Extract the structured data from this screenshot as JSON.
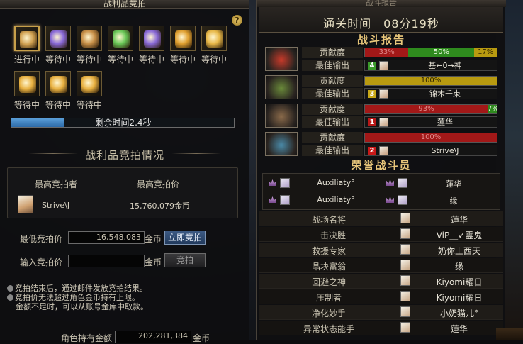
{
  "auction": {
    "title": "战利品竞拍",
    "help_icon": "?",
    "slots": [
      {
        "status": "进行中",
        "icon": "treasure-chest-icon",
        "color": "#d0a050",
        "active": true
      },
      {
        "status": "等待中",
        "icon": "purple-gem-icon",
        "color": "#8a6ad8"
      },
      {
        "status": "等待中",
        "icon": "weapon-bundle-icon",
        "color": "#c89048"
      },
      {
        "status": "等待中",
        "icon": "green-gem-icon",
        "color": "#6ac858"
      },
      {
        "status": "等待中",
        "icon": "purple-gem-icon",
        "color": "#8a6ad8"
      },
      {
        "status": "等待中",
        "icon": "gold-chest-icon",
        "color": "#e0a030"
      },
      {
        "status": "等待中",
        "icon": "gold-gear-icon",
        "color": "#e8b848"
      },
      {
        "status": "等待中",
        "icon": "gold-coin-bag-icon",
        "color": "#e8b040"
      },
      {
        "status": "等待中",
        "icon": "gold-coin-bag-icon",
        "color": "#e8b040"
      },
      {
        "status": "等待中",
        "icon": "gold-coin-bag-icon",
        "color": "#e8b040"
      }
    ],
    "timer": {
      "text": "剩余时间2.4秒",
      "progress_fraction": 0.24
    },
    "section_title": "战利品竞拍情况",
    "top_bidder_header": "最高竞拍者",
    "top_price_header": "最高竞拍价",
    "top_bidder_name": "Strive\\J",
    "top_bid_amount": "15,760,079金币",
    "min_bid_label": "最低竞拍价",
    "min_bid_value": "16,548,083",
    "unit": "金币",
    "buy_now_label": "立即竞拍",
    "input_bid_label": "输入竞拍价",
    "input_bid_value": "",
    "bid_label": "竞拍",
    "notes": [
      "竞拍结束后，通过邮件发放竞拍结果。",
      "竞拍价无法超过角色金币持有上限。",
      "金额不足时，可以从账号金库中取款。"
    ],
    "gold_label": "角色持有金额",
    "gold_value": "202,281,384",
    "gold_unit": "金币"
  },
  "report": {
    "title": "战斗报告",
    "clear_time": "通关时间　08分19秒",
    "battle_report_heading": "战斗报告",
    "contribution_label": "贡献度",
    "best_output_label": "最佳输出",
    "players": [
      {
        "portrait_color": "#c83a2a",
        "segments": [
          {
            "color": "red",
            "value": 33,
            "text": "33%"
          },
          {
            "color": "green",
            "value": 50,
            "text": "50%"
          },
          {
            "color": "gold",
            "value": 17,
            "text": "17%"
          }
        ],
        "rank": "4",
        "rank_color": "#3a9a2a",
        "best": "基←0→神"
      },
      {
        "portrait_color": "#6a8a3a",
        "segments": [
          {
            "color": "gold",
            "value": 100,
            "text": "100%"
          }
        ],
        "rank": "3",
        "rank_color": "#c8a818",
        "best": "锦木千束"
      },
      {
        "portrait_color": "#8a6a4a",
        "segments": [
          {
            "color": "red",
            "value": 93,
            "text": "93%"
          },
          {
            "color": "green",
            "value": 7,
            "text": "7%"
          }
        ],
        "rank": "1",
        "rank_color": "#b81818",
        "best": "蓮华"
      },
      {
        "portrait_color": "#4a8aa8",
        "segments": [
          {
            "color": "red",
            "value": 100,
            "text": "100%"
          }
        ],
        "rank": "2",
        "rank_color": "#c81818",
        "best": "Strive\\J"
      }
    ],
    "honor_heading": "荣誉战斗员",
    "honor_members": [
      "Auxiliaty°",
      "蓮华",
      "Auxiliaty°",
      "缘"
    ],
    "awards": [
      {
        "title": "战场名将",
        "name": "蓮华"
      },
      {
        "title": "一击决胜",
        "name": "ViP＿✓霊鬼"
      },
      {
        "title": "救援专家",
        "name": "奶你上西天"
      },
      {
        "title": "晶块富翁",
        "name": "缘"
      },
      {
        "title": "回避之神",
        "name": "Kiyomi耀日"
      },
      {
        "title": "压制者",
        "name": "Kiyomi耀日"
      },
      {
        "title": "净化妙手",
        "name": "小奶猫儿°"
      },
      {
        "title": "异常状态能手",
        "name": "蓮华"
      }
    ]
  }
}
